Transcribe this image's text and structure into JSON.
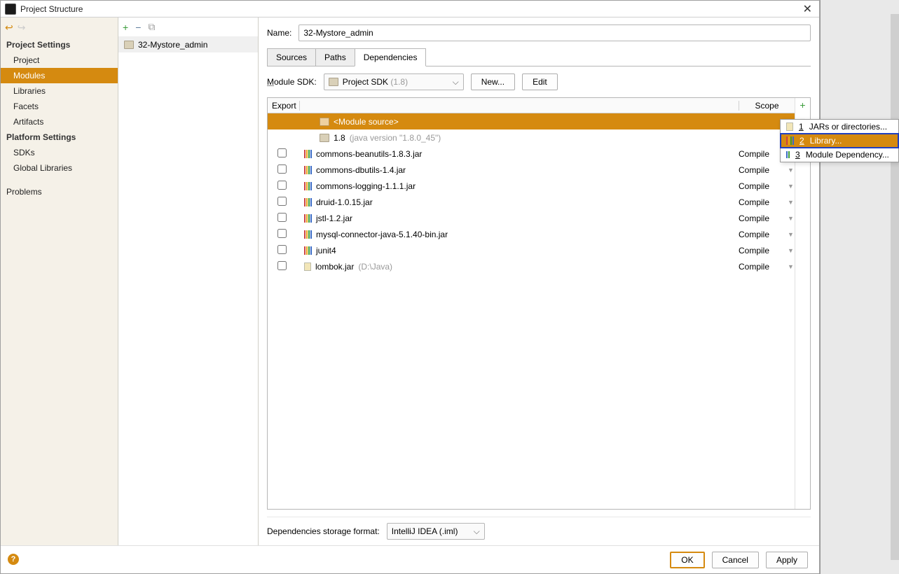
{
  "title": "Project Structure",
  "sidebar": {
    "headings": [
      "Project Settings",
      "Platform Settings"
    ],
    "project": [
      "Project",
      "Modules",
      "Libraries",
      "Facets",
      "Artifacts"
    ],
    "platform": [
      "SDKs",
      "Global Libraries"
    ],
    "problems": "Problems",
    "selected": "Modules"
  },
  "modules_list": [
    "32-Mystore_admin"
  ],
  "name_label": "Name:",
  "name_value": "32-Mystore_admin",
  "tabs": [
    "Sources",
    "Paths",
    "Dependencies"
  ],
  "active_tab": "Dependencies",
  "sdk": {
    "label": "Module SDK:",
    "value": "Project SDK",
    "suffix": "(1.8)",
    "new_btn": "New...",
    "edit_btn": "Edit"
  },
  "table": {
    "head_export": "Export",
    "head_scope": "Scope",
    "rows": [
      {
        "type": "source",
        "name": "<Module source>",
        "selected": true
      },
      {
        "type": "jdk",
        "name": "1.8",
        "suffix": "(java version \"1.8.0_45\")"
      },
      {
        "type": "lib",
        "name": "commons-beanutils-1.8.3.jar",
        "scope": "Compile",
        "cb": true
      },
      {
        "type": "lib",
        "name": "commons-dbutils-1.4.jar",
        "scope": "Compile",
        "cb": true
      },
      {
        "type": "lib",
        "name": "commons-logging-1.1.1.jar",
        "scope": "Compile",
        "cb": true
      },
      {
        "type": "lib",
        "name": "druid-1.0.15.jar",
        "scope": "Compile",
        "cb": true
      },
      {
        "type": "lib",
        "name": "jstl-1.2.jar",
        "scope": "Compile",
        "cb": true
      },
      {
        "type": "lib",
        "name": "mysql-connector-java-5.1.40-bin.jar",
        "scope": "Compile",
        "cb": true
      },
      {
        "type": "lib",
        "name": "junit4",
        "scope": "Compile",
        "cb": true
      },
      {
        "type": "jar",
        "name": "lombok.jar",
        "suffix": "(D:\\Java)",
        "scope": "Compile",
        "cb": true
      }
    ]
  },
  "storage": {
    "label": "Dependencies storage format:",
    "value": "IntelliJ IDEA (.iml)"
  },
  "buttons": {
    "ok": "OK",
    "cancel": "Cancel",
    "apply": "Apply"
  },
  "popup": [
    {
      "num": "1",
      "label": "JARs or directories..."
    },
    {
      "num": "2",
      "label": "Library...",
      "selected": true
    },
    {
      "num": "3",
      "label": "Module Dependency..."
    }
  ]
}
